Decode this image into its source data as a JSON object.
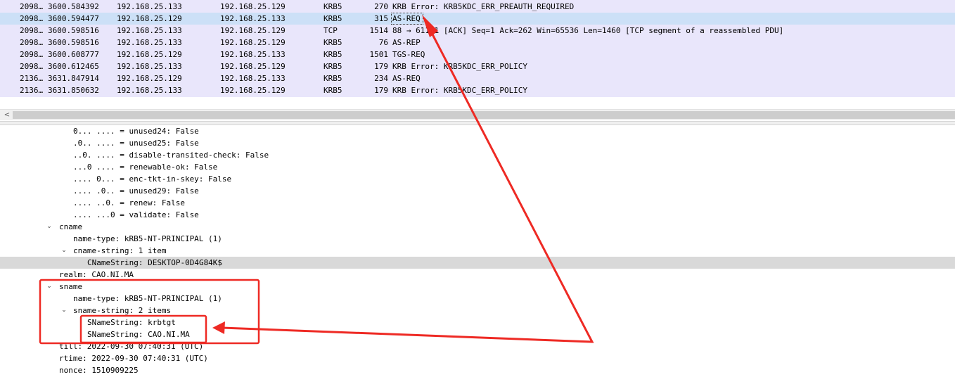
{
  "packet_list": {
    "rows": [
      {
        "no": "2098…",
        "time": "3600.584392",
        "src": "192.168.25.133",
        "dst": "192.168.25.129",
        "proto": "KRB5",
        "len": "270",
        "info": "KRB Error: KRB5KDC_ERR_PREAUTH_REQUIRED"
      },
      {
        "no": "2098…",
        "time": "3600.594477",
        "src": "192.168.25.129",
        "dst": "192.168.25.133",
        "proto": "KRB5",
        "len": "315",
        "info": "AS-REQ"
      },
      {
        "no": "2098…",
        "time": "3600.598516",
        "src": "192.168.25.133",
        "dst": "192.168.25.129",
        "proto": "TCP",
        "len": "1514",
        "info": "88 → 61141 [ACK] Seq=1 Ack=262 Win=65536 Len=1460 [TCP segment of a reassembled PDU]"
      },
      {
        "no": "2098…",
        "time": "3600.598516",
        "src": "192.168.25.133",
        "dst": "192.168.25.129",
        "proto": "KRB5",
        "len": "76",
        "info": "AS-REP"
      },
      {
        "no": "2098…",
        "time": "3600.608777",
        "src": "192.168.25.129",
        "dst": "192.168.25.133",
        "proto": "KRB5",
        "len": "1501",
        "info": "TGS-REQ"
      },
      {
        "no": "2098…",
        "time": "3600.612465",
        "src": "192.168.25.133",
        "dst": "192.168.25.129",
        "proto": "KRB5",
        "len": "179",
        "info": "KRB Error: KRB5KDC_ERR_POLICY"
      },
      {
        "no": "2136…",
        "time": "3631.847914",
        "src": "192.168.25.129",
        "dst": "192.168.25.133",
        "proto": "KRB5",
        "len": "234",
        "info": "AS-REQ"
      },
      {
        "no": "2136…",
        "time": "3631.850632",
        "src": "192.168.25.133",
        "dst": "192.168.25.129",
        "proto": "KRB5",
        "len": "179",
        "info": "KRB Error: KRB5KDC_ERR_POLICY"
      }
    ],
    "selected_index": 1
  },
  "scrollbar": {
    "left_arrow": "<"
  },
  "details": {
    "rows": [
      {
        "text": "0... .... = unused24: False"
      },
      {
        "text": ".0.. .... = unused25: False"
      },
      {
        "text": "..0. .... = disable-transited-check: False"
      },
      {
        "text": "...0 .... = renewable-ok: False"
      },
      {
        "text": ".... 0... = enc-tkt-in-skey: False"
      },
      {
        "text": ".... .0.. = unused29: False"
      },
      {
        "text": ".... ..0. = renew: False"
      },
      {
        "text": ".... ...0 = validate: False"
      },
      {
        "text": "cname",
        "expander": "expanded"
      },
      {
        "text": "name-type: kRB5-NT-PRINCIPAL (1)"
      },
      {
        "text": "cname-string: 1 item",
        "expander": "expanded"
      },
      {
        "text": "CNameString: DESKTOP-0D4G84K$",
        "highlighted": true
      },
      {
        "text": "realm: CAO.NI.MA"
      },
      {
        "text": "sname",
        "expander": "expanded"
      },
      {
        "text": "name-type: kRB5-NT-PRINCIPAL (1)"
      },
      {
        "text": "sname-string: 2 items",
        "expander": "expanded"
      },
      {
        "text": "SNameString: krbtgt"
      },
      {
        "text": "SNameString: CAO.NI.MA"
      },
      {
        "text": "till: 2022-09-30 07:40:31 (UTC)"
      },
      {
        "text": "rtime: 2022-09-30 07:40:31 (UTC)"
      },
      {
        "text": "nonce: 1510909225"
      }
    ]
  },
  "colors": {
    "packet_list_bg": "#e9e6fb",
    "selected_row_bg": "#cce0f7",
    "highlighted_field_bg": "#d9d9d9",
    "annotation_red": "#ee2a24"
  },
  "icons": {
    "expander": "chevron-down-icon",
    "scroll_left": "chevron-left-icon"
  }
}
